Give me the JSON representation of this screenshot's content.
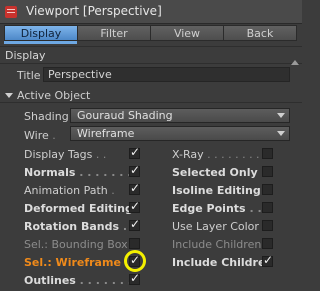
{
  "window": {
    "title": "Viewport [Perspective]",
    "tabs": [
      {
        "label": "Display",
        "active": true
      },
      {
        "label": "Filter",
        "active": false
      },
      {
        "label": "View",
        "active": false
      },
      {
        "label": "Back",
        "active": false
      }
    ]
  },
  "section": {
    "title": "Display"
  },
  "title_field": {
    "label": "Title",
    "value": "Perspective"
  },
  "group": {
    "label": "Active Object"
  },
  "shading": {
    "label": "Shading",
    "value": "Gouraud Shading"
  },
  "wire": {
    "label": "Wire",
    "value": "Wireframe"
  },
  "left_options": [
    {
      "label": "Display Tags",
      "checked": true
    },
    {
      "label": "Normals",
      "checked": true
    },
    {
      "label": "Animation Path",
      "checked": true
    },
    {
      "label": "Deformed Editing",
      "checked": true
    },
    {
      "label": "Rotation Bands",
      "checked": true
    },
    {
      "label": "Sel.: Bounding Box",
      "checked": false
    },
    {
      "label": "Sel.: Wireframe",
      "checked": true
    },
    {
      "label": "Outlines",
      "checked": true
    }
  ],
  "right_options": [
    {
      "label": "X-Ray",
      "checked": false
    },
    {
      "label": "Selected Only",
      "checked": false
    },
    {
      "label": "Isoline Editing",
      "checked": false
    },
    {
      "label": "Edge Points",
      "checked": false
    },
    {
      "label": "Use Layer Color",
      "checked": false
    },
    {
      "label": "Include Children",
      "checked": false
    },
    {
      "label": "Include Children",
      "checked": true
    }
  ],
  "colors": {
    "accent": "#6ea8e3",
    "highlight_ring": "#f4f000",
    "orange_label": "#f08a1a"
  }
}
